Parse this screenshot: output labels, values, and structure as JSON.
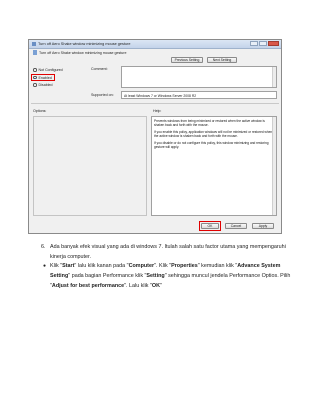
{
  "dialog": {
    "title": "Turn off Aero Shake window minimizing mouse gesture",
    "policy_name": "Turn off Aero Shake window minimizing mouse gesture",
    "prev_label": "Previous Setting",
    "next_label": "Next Setting",
    "options": [
      {
        "label": "Not Configured",
        "selected": false
      },
      {
        "label": "Enabled",
        "selected": true
      },
      {
        "label": "Disabled",
        "selected": false
      }
    ],
    "comment_label": "Comment:",
    "supported_label": "Supported on:",
    "supported_value": "At least Windows 7 or Windows Server 2008 R2",
    "options_heading": "Options:",
    "help_heading": "Help:",
    "help_paragraphs": [
      "Prevents windows from being minimized or restored when the active window is shaken back and forth with the mouse.",
      "If you enable this policy, application windows will not be minimized or restored when the active window is shaken back and forth with the mouse.",
      "If you disable or do not configure this policy, this window minimizing and restoring gesture will apply."
    ],
    "ok_label": "OK",
    "cancel_label": "Cancel",
    "apply_label": "Apply"
  },
  "document": {
    "item_number": "6.",
    "item_text": "Ada banyak efek visual  yang ada di windows 7. Itulah salah satu factor utama yang mempengaruhi kinerja computer.",
    "bullet_symbol": "●",
    "bullet": {
      "t1": "Klik \"",
      "b1": "Start",
      "t2": "\" lalu klik kanan pada \"",
      "b2": "Computer",
      "t3": "\". Klik \"",
      "b3": "Properties",
      "t4": "\" kemudian klik \"",
      "b4": "Advance System Setting",
      "t5": "\" pada bagian Performance klik \"",
      "b5": "Setting",
      "t6": "\" sehingga muncul jendela Performance Optios. Pilih \"",
      "b6": "Adjust for best performance",
      "t7": "\". Lalu klik \"",
      "b7": "OK",
      "t8": "\""
    }
  }
}
